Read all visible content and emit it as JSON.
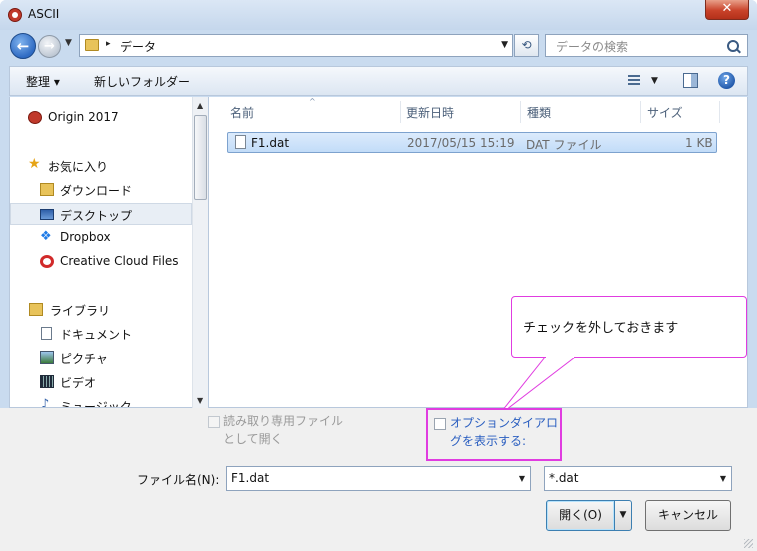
{
  "window": {
    "title": "ASCII",
    "close_label": "✕"
  },
  "address_bar": {
    "breadcrumb_arrow": "▸",
    "location": "データ",
    "dropdown": "▾"
  },
  "search": {
    "placeholder": "データの検索"
  },
  "toolbar": {
    "organize_label": "整理 ▾",
    "new_folder_label": "新しいフォルダー",
    "view_dropdown": "▾",
    "help": "?"
  },
  "sidebar": {
    "items": [
      {
        "label": "Origin 2017",
        "icon": "origin-icon"
      },
      {
        "label": "お気に入り",
        "icon": "star-icon"
      },
      {
        "label": "ダウンロード",
        "icon": "download-folder-icon"
      },
      {
        "label": "デスクトップ",
        "icon": "desktop-icon",
        "selected": true
      },
      {
        "label": "Dropbox",
        "icon": "dropbox-icon"
      },
      {
        "label": "Creative Cloud Files",
        "icon": "creative-cloud-icon"
      },
      {
        "label": "ライブラリ",
        "icon": "library-icon"
      },
      {
        "label": "ドキュメント",
        "icon": "document-icon"
      },
      {
        "label": "ピクチャ",
        "icon": "picture-icon"
      },
      {
        "label": "ビデオ",
        "icon": "video-icon"
      },
      {
        "label": "ミュージック",
        "icon": "music-icon"
      }
    ]
  },
  "file_list": {
    "columns": [
      "名前",
      "更新日時",
      "種類",
      "サイズ"
    ],
    "sort_indicator": "^",
    "rows": [
      {
        "name": "F1.dat",
        "modified": "2017/05/15 15:19",
        "type": "DAT ファイル",
        "size": "1 KB"
      }
    ]
  },
  "callout": {
    "text": "チェックを外しておきます",
    "color": "#e03ce0"
  },
  "options": {
    "readonly_label": "読み取り専用ファイルとして開く",
    "show_dialog_label": "オプションダイアログを表示する:"
  },
  "filename": {
    "label": "ファイル名(N):",
    "value": "F1.dat"
  },
  "filter": {
    "value": "*.dat"
  },
  "buttons": {
    "open": "開く(O)",
    "cancel": "キャンセル"
  }
}
